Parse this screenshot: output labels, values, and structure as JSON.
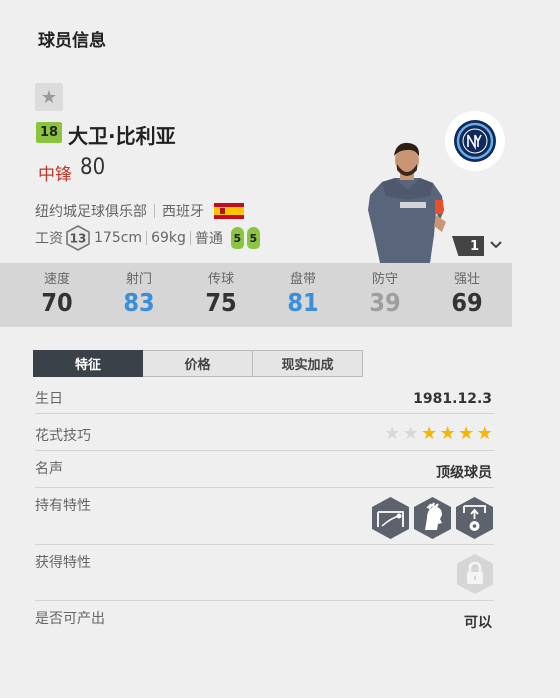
{
  "page": {
    "title": "球员信息"
  },
  "player": {
    "overall": "18",
    "name": "大卫·比利亚",
    "position": "中锋",
    "position_rating": "80",
    "club": "纽约城足球俱乐部",
    "nation": "西班牙",
    "wage_label": "工资",
    "wage": "13",
    "height": "175cm",
    "weight": "69kg",
    "body_type": "普通",
    "weak_foot_left": "5",
    "weak_foot_right": "5",
    "season_level": "1"
  },
  "icons": {
    "favorite": "star-icon",
    "club_crest": "nycfc-crest-icon",
    "nation_flag": "spain-flag-icon",
    "season_expand": "chevron-down-icon"
  },
  "stats": [
    {
      "label": "速度",
      "value": "70",
      "color": "#333333"
    },
    {
      "label": "射门",
      "value": "83",
      "color": "#3a8fd6"
    },
    {
      "label": "传球",
      "value": "75",
      "color": "#333333"
    },
    {
      "label": "盘带",
      "value": "81",
      "color": "#3a8fd6"
    },
    {
      "label": "防守",
      "value": "39",
      "color": "#9e9e9e"
    },
    {
      "label": "强壮",
      "value": "69",
      "color": "#333333"
    }
  ],
  "tabs": [
    {
      "label": "特征",
      "active": true
    },
    {
      "label": "价格",
      "active": false
    },
    {
      "label": "现实加成",
      "active": false
    }
  ],
  "attributes": {
    "birthday": {
      "label": "生日",
      "value": "1981.12.3"
    },
    "skill_moves": {
      "label": "花式技巧",
      "stars_filled": 4,
      "stars_total": 6,
      "star_color": "#f2b705"
    },
    "reputation": {
      "label": "名声",
      "value": "顶级球员"
    },
    "traits": {
      "label": "持有特性",
      "icons": [
        "finesse-shot-icon",
        "flair-player-icon",
        "penalty-taker-icon"
      ]
    },
    "acquired_traits": {
      "label": "获得特性",
      "icon": "lock-icon"
    },
    "producible": {
      "label": "是否可产出",
      "value": "可以"
    }
  },
  "colors": {
    "accent_green": "#8bc53f",
    "position_red": "#c0392b",
    "tab_active": "#3b4148"
  }
}
